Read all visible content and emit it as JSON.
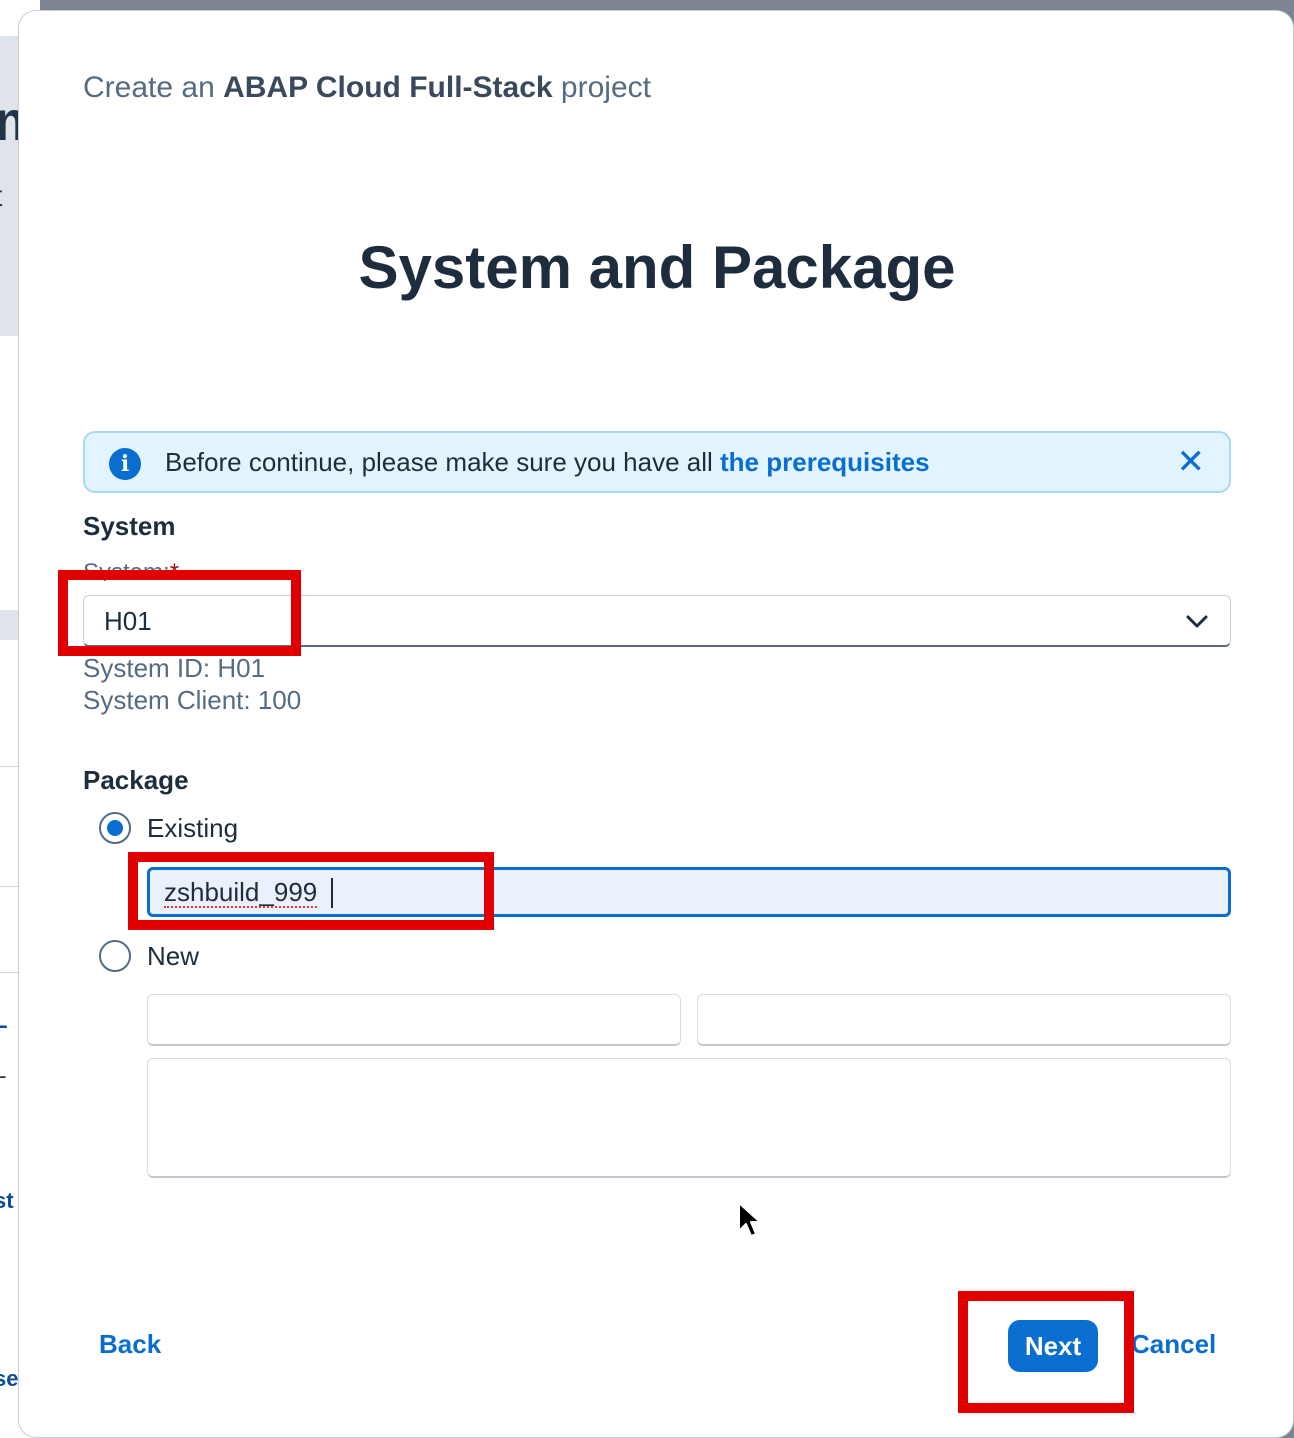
{
  "background": {
    "fragments": [
      "m",
      "t",
      "L",
      "L",
      "st",
      "se"
    ]
  },
  "dialog": {
    "subtitle_prefix": "Create an",
    "subtitle_bold": "ABAP Cloud Full-Stack",
    "subtitle_suffix": "project",
    "title": "System and Package",
    "info_strip": {
      "icon": "info-icon",
      "text": "Before continue, please make sure you have all",
      "link_text": "the prerequisites",
      "close_icon": "close-icon"
    },
    "system": {
      "heading": "System",
      "label": "System:",
      "required_mark": "*",
      "selected_value": "H01",
      "system_id": "System ID: H01",
      "system_client": "System Client: 100"
    },
    "package": {
      "heading": "Package",
      "existing_label": "Existing",
      "existing_selected": true,
      "existing_value": "zshbuild_999",
      "new_label": "New",
      "new_selected": false
    },
    "footer": {
      "back_label": "Back",
      "next_label": "Next",
      "cancel_label": "Cancel"
    }
  },
  "colors": {
    "accent": "#0a6ed1",
    "highlight": "#e00000",
    "info_bg": "#e1f4ff"
  }
}
